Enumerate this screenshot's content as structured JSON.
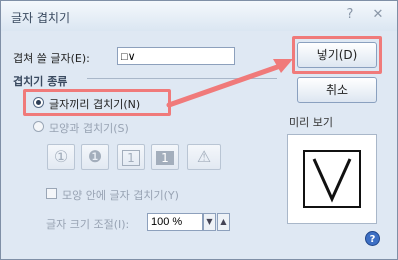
{
  "dialog": {
    "title": "글자 겹치기",
    "help_glyph": "?",
    "close_glyph": "✕"
  },
  "overlap_text": {
    "label": "겹쳐 쓸 글자(E):",
    "value": "□∨"
  },
  "overlap_type": {
    "group_label": "겹치기 종류",
    "option_chars": "글자끼리 겹치기(N)",
    "option_shape": "모양과 겹치기(S)",
    "selected": "option_chars"
  },
  "shape_buttons": [
    {
      "name": "circle-outline-shape",
      "glyph": "①"
    },
    {
      "name": "circle-filled-shape",
      "glyph": "❶"
    },
    {
      "name": "square-outline-shape",
      "glyph": "1"
    },
    {
      "name": "square-filled-shape",
      "glyph": "1"
    },
    {
      "name": "triangle-shape",
      "glyph": "⚠"
    }
  ],
  "inside_shape": {
    "label": "모양 안에 글자 겹치기(Y)",
    "checked": false
  },
  "size_adjust": {
    "label": "글자 크기 조절(I):",
    "value": "100 %"
  },
  "buttons": {
    "insert": "넣기(D)",
    "cancel": "취소"
  },
  "preview": {
    "label": "미리 보기",
    "glyph": "∨"
  },
  "colors": {
    "highlight": "#f07a7a",
    "dialog_bg": "#dfe8f3"
  }
}
